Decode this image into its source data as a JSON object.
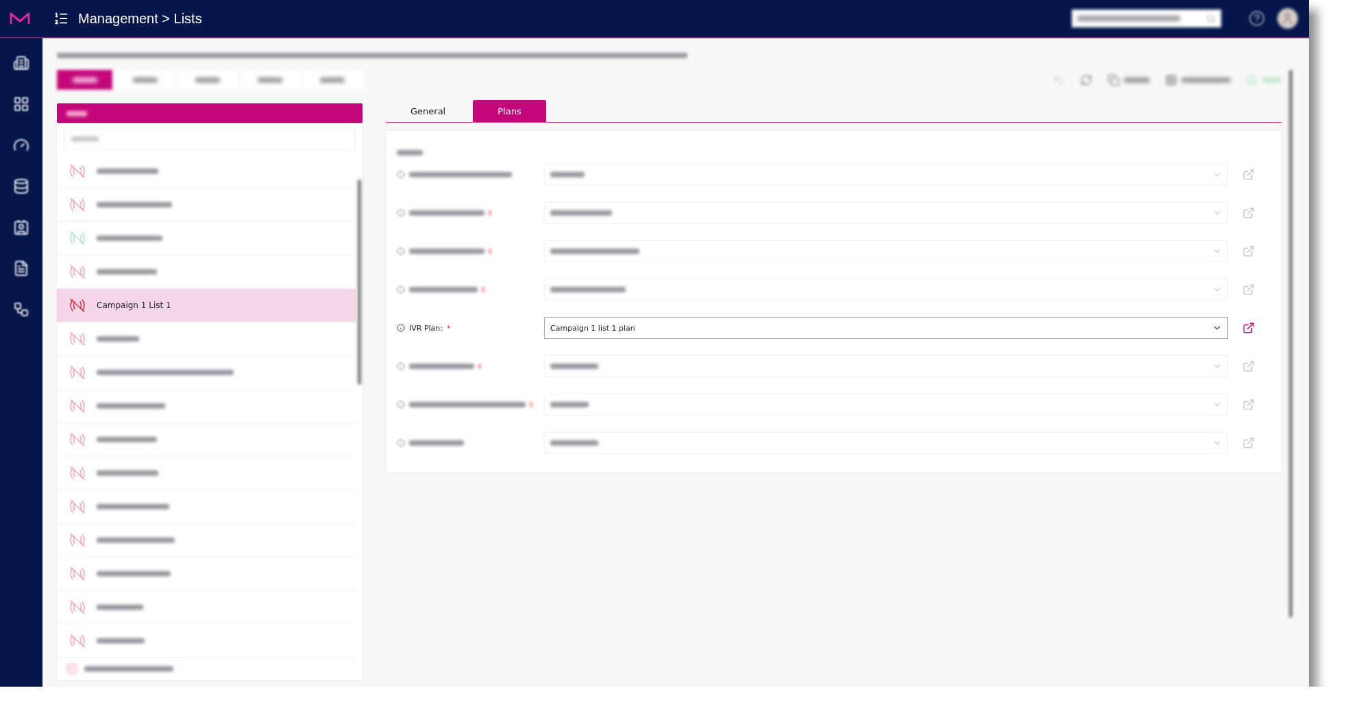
{
  "header": {
    "breadcrumb": "Management > Lists"
  },
  "filter_tabs": [
    {
      "selected": true
    },
    {
      "selected": false
    },
    {
      "selected": false
    },
    {
      "selected": false
    },
    {
      "selected": false
    }
  ],
  "list": {
    "items": [
      {
        "selected": false,
        "color": "#f2a8b4"
      },
      {
        "selected": false,
        "color": "#f2a8b4"
      },
      {
        "selected": false,
        "color": "#b6e3c3"
      },
      {
        "selected": false,
        "color": "#f2a8b4"
      },
      {
        "label": "Campaign 1 List 1",
        "selected": true,
        "color": "#d8304c"
      },
      {
        "selected": false,
        "color": "#f2a8b4"
      },
      {
        "selected": false,
        "color": "#f2a8b4"
      },
      {
        "selected": false,
        "color": "#f2a8b4"
      },
      {
        "selected": false,
        "color": "#f2a8b4"
      },
      {
        "selected": false,
        "color": "#f2a8b4"
      },
      {
        "selected": false,
        "color": "#f2a8b4"
      },
      {
        "selected": false,
        "color": "#f2a8b4"
      },
      {
        "selected": false,
        "color": "#f2a8b4"
      },
      {
        "selected": false,
        "color": "#f2a8b4"
      },
      {
        "selected": false,
        "color": "#f2a8b4"
      }
    ]
  },
  "detail_tabs": [
    {
      "label": "General",
      "selected": false
    },
    {
      "label": "Plans",
      "selected": true
    }
  ],
  "plans": [
    {
      "blurred": true,
      "required": false
    },
    {
      "blurred": true,
      "required": true
    },
    {
      "blurred": true,
      "required": true
    },
    {
      "blurred": true,
      "required": true
    },
    {
      "blurred": false,
      "label": "IVR Plan:",
      "required_mark": "*",
      "value": "Campaign 1 list 1 plan"
    },
    {
      "blurred": true,
      "required": true
    },
    {
      "blurred": true,
      "required": true
    },
    {
      "blurred": true,
      "required": false
    }
  ]
}
